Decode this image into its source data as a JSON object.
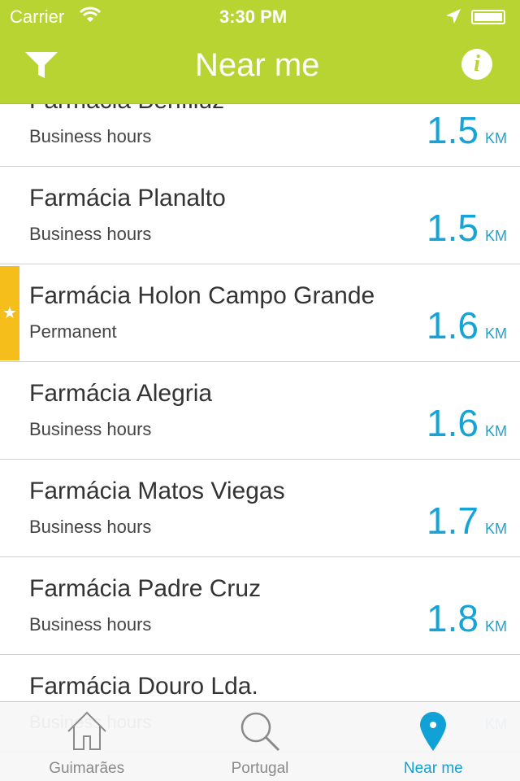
{
  "status": {
    "carrier": "Carrier",
    "time": "3:30 PM"
  },
  "nav": {
    "title": "Near me",
    "left_icon": "filter-icon",
    "right_icon": "info-icon",
    "info_glyph": "i"
  },
  "colors": {
    "accent": "#b8d432",
    "distance": "#16a4d6",
    "favorite": "#f5be1a"
  },
  "list": [
    {
      "name": "Farmácia Benfiluz",
      "hours": "Business hours",
      "distance": "1.5",
      "unit": "KM",
      "favorite": false
    },
    {
      "name": "Farmácia Planalto",
      "hours": "Business hours",
      "distance": "1.5",
      "unit": "KM",
      "favorite": false
    },
    {
      "name": "Farmácia Holon Campo Grande",
      "hours": "Permanent",
      "distance": "1.6",
      "unit": "KM",
      "favorite": true
    },
    {
      "name": "Farmácia Alegria",
      "hours": "Business hours",
      "distance": "1.6",
      "unit": "KM",
      "favorite": false
    },
    {
      "name": "Farmácia Matos Viegas",
      "hours": "Business hours",
      "distance": "1.7",
      "unit": "KM",
      "favorite": false
    },
    {
      "name": "Farmácia Padre Cruz",
      "hours": "Business hours",
      "distance": "1.8",
      "unit": "KM",
      "favorite": false
    },
    {
      "name": "Farmácia Douro Lda.",
      "hours": "Business hours",
      "distance": "",
      "unit": "KM",
      "favorite": false
    }
  ],
  "tabs": [
    {
      "label": "Guimarães",
      "icon": "home-icon",
      "active": false
    },
    {
      "label": "Portugal",
      "icon": "search-icon",
      "active": false
    },
    {
      "label": "Near me",
      "icon": "location-pin-icon",
      "active": true
    }
  ]
}
